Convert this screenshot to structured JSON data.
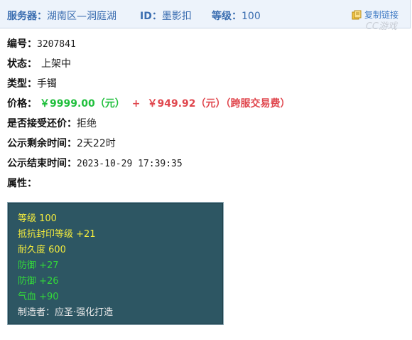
{
  "header": {
    "server_label": "服务器：",
    "server_value": "湖南区—洞庭湖",
    "id_label": "ID：",
    "id_value": "墨影扣",
    "level_label": "等级：",
    "level_value": "100",
    "copy_label": "复制链接",
    "watermark": "CC游戏"
  },
  "fields": {
    "number_label": "编号：",
    "number_value": "3207841",
    "status_label": "状态：",
    "status_value": "上架中",
    "type_label": "类型：",
    "type_value": "手镯",
    "price_label": "价格：",
    "price_value": "￥9999.00（元）",
    "price_plus": "+",
    "fee_value": "￥949.92（元）（跨服交易费）",
    "bargain_label": "是否接受还价：",
    "bargain_value": "拒绝",
    "remaining_label": "公示剩余时间：",
    "remaining_value": "2天22时",
    "end_label": "公示结束时间：",
    "end_value": "2023-10-29 17:39:35",
    "attr_label": "属性："
  },
  "attributes": [
    {
      "text": "等级 100",
      "color": "#f2ea3d"
    },
    {
      "text": "抵抗封印等级 +21",
      "color": "#f2ea3d"
    },
    {
      "text": "耐久度 600",
      "color": "#f2ea3d"
    },
    {
      "text": "防御 +27",
      "color": "#33d93a"
    },
    {
      "text": "防御 +26",
      "color": "#33d93a"
    },
    {
      "text": "气血 +90",
      "color": "#33d93a"
    },
    {
      "text": "制造者：应圣·强化打造",
      "color": "#e8e8e8"
    }
  ]
}
